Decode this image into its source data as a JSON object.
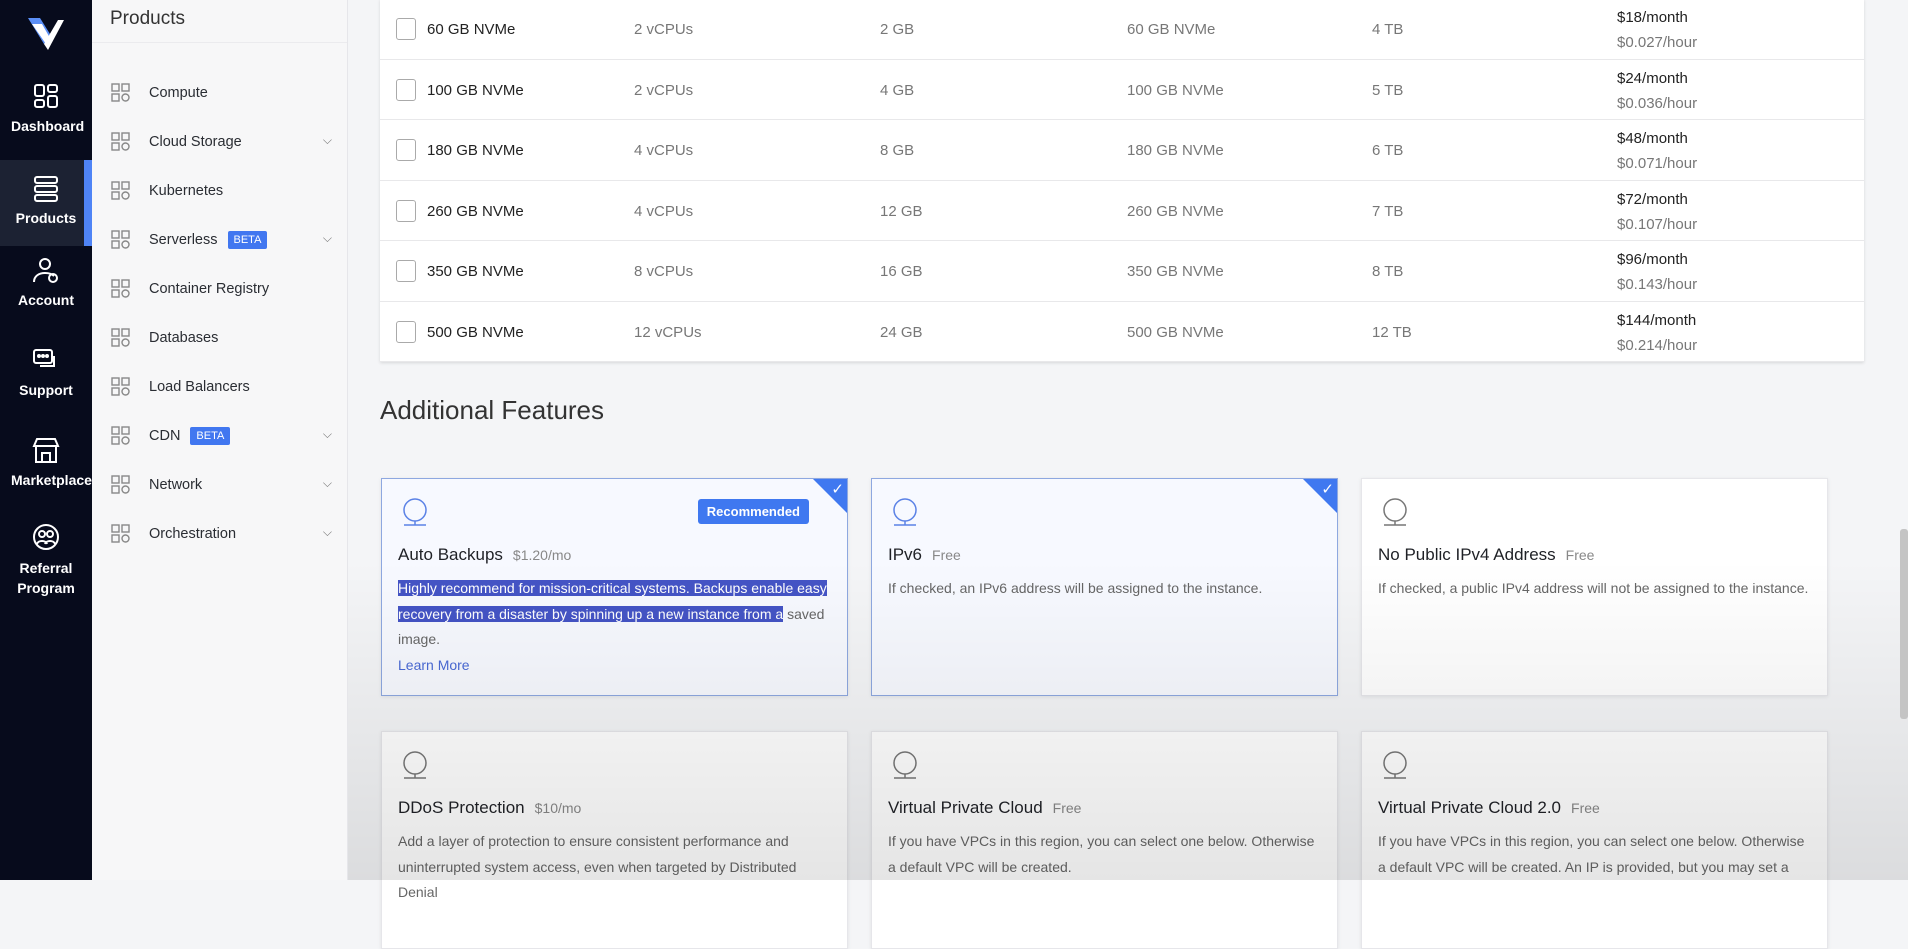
{
  "rail": [
    {
      "label": "Dashboard",
      "icon": "dashboard-icon"
    },
    {
      "label": "Products",
      "icon": "server-icon",
      "active": true
    },
    {
      "label": "Account",
      "icon": "account-icon"
    },
    {
      "label": "Support",
      "icon": "support-icon"
    },
    {
      "label": "Marketplace",
      "icon": "store-icon"
    },
    {
      "label": "Referral Program",
      "icon": "referral-icon"
    }
  ],
  "panel": {
    "title": "Products",
    "items": [
      {
        "label": "Compute"
      },
      {
        "label": "Cloud Storage",
        "chevron": true
      },
      {
        "label": "Kubernetes"
      },
      {
        "label": "Serverless",
        "badge": "BETA",
        "chevron": true
      },
      {
        "label": "Container Registry"
      },
      {
        "label": "Databases"
      },
      {
        "label": "Load Balancers"
      },
      {
        "label": "CDN",
        "badge": "BETA",
        "chevron": true
      },
      {
        "label": "Network",
        "chevron": true
      },
      {
        "label": "Orchestration",
        "chevron": true
      }
    ]
  },
  "plans": [
    {
      "name": "60 GB NVMe",
      "cpu": "2 vCPUs",
      "ram": "2 GB",
      "storage": "60 GB NVMe",
      "bw": "4 TB",
      "month": "$18/month",
      "hour": "$0.027/hour"
    },
    {
      "name": "100 GB NVMe",
      "cpu": "2 vCPUs",
      "ram": "4 GB",
      "storage": "100 GB NVMe",
      "bw": "5 TB",
      "month": "$24/month",
      "hour": "$0.036/hour"
    },
    {
      "name": "180 GB NVMe",
      "cpu": "4 vCPUs",
      "ram": "8 GB",
      "storage": "180 GB NVMe",
      "bw": "6 TB",
      "month": "$48/month",
      "hour": "$0.071/hour"
    },
    {
      "name": "260 GB NVMe",
      "cpu": "4 vCPUs",
      "ram": "12 GB",
      "storage": "260 GB NVMe",
      "bw": "7 TB",
      "month": "$72/month",
      "hour": "$0.107/hour"
    },
    {
      "name": "350 GB NVMe",
      "cpu": "8 vCPUs",
      "ram": "16 GB",
      "storage": "350 GB NVMe",
      "bw": "8 TB",
      "month": "$96/month",
      "hour": "$0.143/hour"
    },
    {
      "name": "500 GB NVMe",
      "cpu": "12 vCPUs",
      "ram": "24 GB",
      "storage": "500 GB NVMe",
      "bw": "12 TB",
      "month": "$144/month",
      "hour": "$0.214/hour"
    }
  ],
  "features": {
    "title": "Additional Features",
    "cards": [
      {
        "title": "Auto Backups",
        "price": "$1.20/mo",
        "badge": "Recommended",
        "desc_highlight": "Highly recommend for mission-critical systems. Backups enable easy recovery from a disaster by spinning up a new instance from a",
        "desc_rest": " saved image.",
        "link": "Learn More",
        "selected": true
      },
      {
        "title": "IPv6",
        "price": "Free",
        "desc": "If checked, an IPv6 address will be assigned to the instance.",
        "selected": true
      },
      {
        "title": "No Public IPv4 Address",
        "price": "Free",
        "desc": "If checked, a public IPv4 address will not be assigned to the instance.",
        "selected": false
      },
      {
        "title": "DDoS Protection",
        "price": "$10/mo",
        "desc": "Add a layer of protection to ensure consistent performance and uninterrupted system access, even when targeted by Distributed Denial",
        "selected": false
      },
      {
        "title": "Virtual Private Cloud",
        "price": "Free",
        "desc": "If you have VPCs in this region, you can select one below. Otherwise a default VPC will be created.",
        "selected": false
      },
      {
        "title": "Virtual Private Cloud 2.0",
        "price": "Free",
        "desc": "If you have VPCs in this region, you can select one below. Otherwise a default VPC will be created. An IP is provided, but you may set a",
        "selected": false
      }
    ]
  },
  "colors": {
    "accent": "#3f78f0",
    "rail": "#070b1c",
    "highlight": "#4454c5"
  }
}
